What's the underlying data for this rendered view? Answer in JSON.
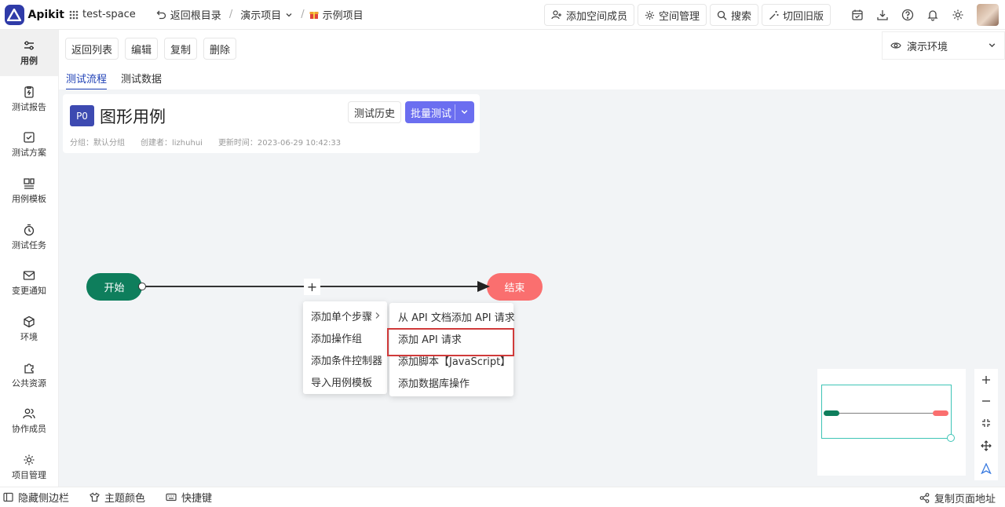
{
  "topbar": {
    "app_name": "Apikit",
    "space": "test-space",
    "back_root": "返回根目录",
    "project": "演示项目",
    "case_item": "示例项目",
    "add_member": "添加空间成员",
    "space_manage": "空间管理",
    "search": "搜索",
    "old_version": "切回旧版"
  },
  "sidebar": {
    "items": [
      {
        "label": "用例",
        "icon": "sliders-icon"
      },
      {
        "label": "测试报告",
        "icon": "report-icon"
      },
      {
        "label": "测试方案",
        "icon": "checkbox-icon"
      },
      {
        "label": "用例模板",
        "icon": "template-icon"
      },
      {
        "label": "测试任务",
        "icon": "timer-icon"
      },
      {
        "label": "变更通知",
        "icon": "mail-icon"
      },
      {
        "label": "环境",
        "icon": "cube-icon"
      },
      {
        "label": "公共资源",
        "icon": "puzzle-icon"
      },
      {
        "label": "协作成员",
        "icon": "users-icon"
      },
      {
        "label": "项目管理",
        "icon": "gear-icon"
      }
    ]
  },
  "actions": {
    "back_list": "返回列表",
    "edit": "编辑",
    "copy": "复制",
    "delete": "删除"
  },
  "env": {
    "label": "演示环境"
  },
  "tabs": {
    "flow": "测试流程",
    "data": "测试数据"
  },
  "case": {
    "priority": "P0",
    "title": "图形用例",
    "group": "分组：默认分组",
    "creator": "创建者：lizhuhui",
    "updated": "更新时间：2023-06-29 10:42:33",
    "history_btn": "测试历史",
    "batch_btn": "批量测试"
  },
  "flow": {
    "start": "开始",
    "end": "结束"
  },
  "menu1": {
    "items": [
      "添加单个步骤",
      "添加操作组",
      "添加条件控制器",
      "导入用例模板"
    ]
  },
  "menu2": {
    "items": [
      "从 API 文档添加 API 请求",
      "添加 API 请求",
      "添加脚本【JavaScript】",
      "添加数据库操作"
    ]
  },
  "bottombar": {
    "hide_sidebar": "隐藏侧边栏",
    "theme": "主题颜色",
    "shortcuts": "快捷键",
    "copy_url": "复制页面地址"
  },
  "colors": {
    "accent": "#6b6ef0",
    "start_node": "#0e7e5c",
    "end_node": "#fa6f6f",
    "highlight": "#d03a3a",
    "priority_badge": "#3d4ab1"
  }
}
